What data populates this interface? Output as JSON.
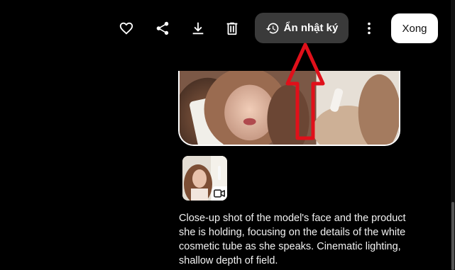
{
  "toolbar": {
    "favorite_icon": "heart-icon",
    "share_icon": "share-icon",
    "download_icon": "download-icon",
    "delete_icon": "trash-icon",
    "hide_log": {
      "icon": "history-icon",
      "label": "Ẩn nhật ký"
    },
    "more_icon": "more-vertical-icon",
    "done_label": "Xong"
  },
  "media": {
    "thumbnail_badge_icon": "video-icon"
  },
  "description": "Close-up shot of the model's face and the product she is holding, focusing on the details of the white cosmetic tube as she speaks. Cinematic lighting, shallow depth of field.",
  "colors": {
    "background": "#000000",
    "button_dark": "#3a3a3a",
    "annotation": "#e0101a"
  }
}
